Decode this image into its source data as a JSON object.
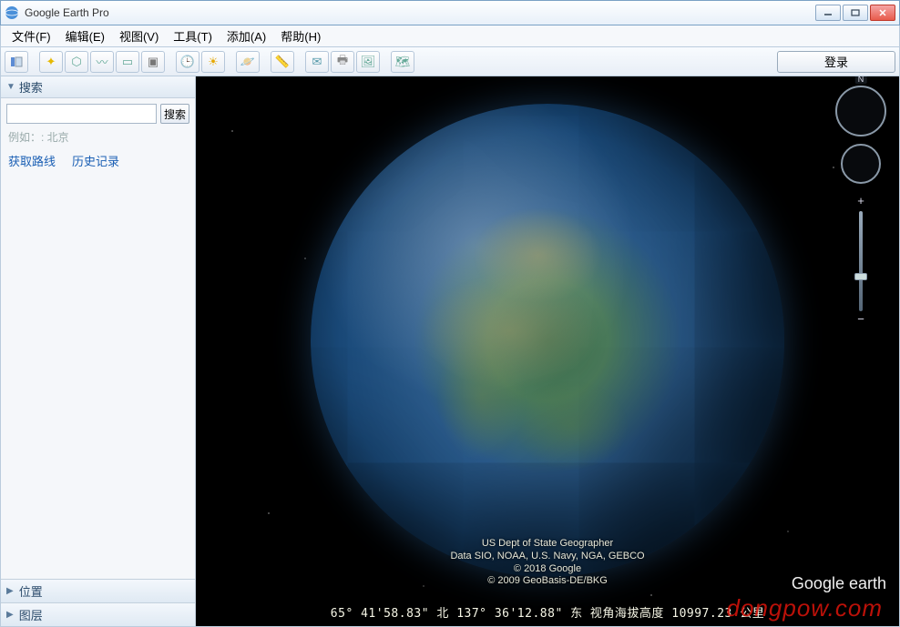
{
  "window": {
    "title": "Google Earth Pro"
  },
  "menu": {
    "file": "文件(F)",
    "edit": "编辑(E)",
    "view": "视图(V)",
    "tools": "工具(T)",
    "add": "添加(A)",
    "help": "帮助(H)"
  },
  "toolbar": {
    "login": "登录"
  },
  "sidebar": {
    "search_header": "搜索",
    "search_button": "搜索",
    "search_placeholder": "",
    "hint": "例如：: 北京",
    "get_directions": "获取路线",
    "history": "历史记录",
    "places": "位置",
    "layers": "图层"
  },
  "nav": {
    "north": "N"
  },
  "attribution": {
    "line1": "US Dept of State Geographer",
    "line2": "Data SIO, NOAA, U.S. Navy, NGA, GEBCO",
    "line3": "© 2018 Google",
    "line4": "© 2009 GeoBasis-DE/BKG"
  },
  "logo": {
    "google": "Google",
    "earth": " earth"
  },
  "status": {
    "text": "65° 41'58.83\" 北 137° 36'12.88\" 东  视角海拔高度  10997.23 公里"
  },
  "watermark": "dongpow.com"
}
